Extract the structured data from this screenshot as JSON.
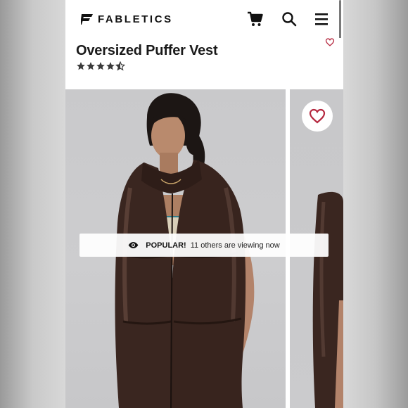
{
  "header": {
    "brand": "FABLETICS",
    "icons": [
      "cart-icon",
      "search-icon",
      "menu-icon"
    ]
  },
  "product": {
    "title": "Oversized Puffer Vest",
    "rating": 4.5,
    "rating_max": 5
  },
  "banner": {
    "label": "POPULAR!",
    "text": "11 others are viewing now"
  },
  "colors": {
    "heart": "#b5283f",
    "vest": "#3a2620",
    "text": "#1a1a1a"
  }
}
